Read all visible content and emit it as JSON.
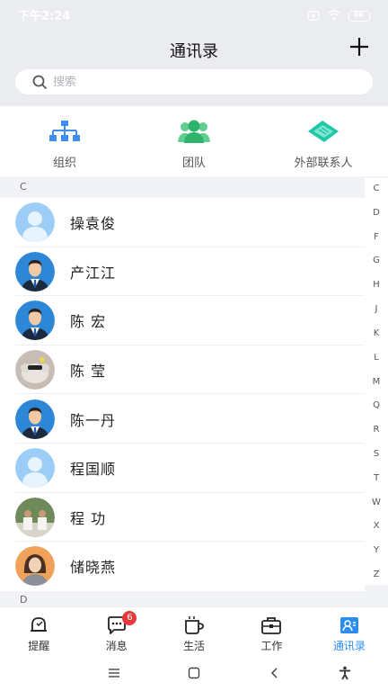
{
  "status_bar": {
    "time": "下午2:24",
    "battery": "88"
  },
  "header": {
    "title": "通讯录"
  },
  "search": {
    "placeholder": "搜索"
  },
  "quick_entries": [
    {
      "label": "组织",
      "icon": "org-chart-icon"
    },
    {
      "label": "团队",
      "icon": "team-icon"
    },
    {
      "label": "外部联系人",
      "icon": "external-contacts-icon"
    }
  ],
  "sections": [
    {
      "letter": "C",
      "contacts": [
        {
          "name": "操袁俊",
          "avatar": "default-avatar"
        },
        {
          "name": "产江江",
          "avatar": "man-suit"
        },
        {
          "name": "陈  宏",
          "avatar": "man-suit"
        },
        {
          "name": "陈  莹",
          "avatar": "photo-cat"
        },
        {
          "name": "陈一丹",
          "avatar": "man-suit"
        },
        {
          "name": "程国顺",
          "avatar": "default-avatar"
        },
        {
          "name": "程  功",
          "avatar": "photo-group"
        },
        {
          "name": "储晓燕",
          "avatar": "woman"
        }
      ]
    },
    {
      "letter": "D",
      "contacts": []
    }
  ],
  "alpha_index": [
    "C",
    "D",
    "F",
    "G",
    "H",
    "J",
    "K",
    "L",
    "M",
    "Q",
    "R",
    "S",
    "T",
    "W",
    "X",
    "Y",
    "Z"
  ],
  "bottom_nav": [
    {
      "label": "提醒",
      "icon": "bell-icon",
      "active": false
    },
    {
      "label": "消息",
      "icon": "chat-icon",
      "active": false,
      "badge": "6"
    },
    {
      "label": "生活",
      "icon": "cup-icon",
      "active": false
    },
    {
      "label": "工作",
      "icon": "briefcase-icon",
      "active": false
    },
    {
      "label": "通讯录",
      "icon": "contacts-icon",
      "active": true
    }
  ],
  "colors": {
    "accent": "#2d8cf0",
    "badge": "#e5383b",
    "team_green": "#3cb371",
    "external_teal": "#20c7a8"
  }
}
